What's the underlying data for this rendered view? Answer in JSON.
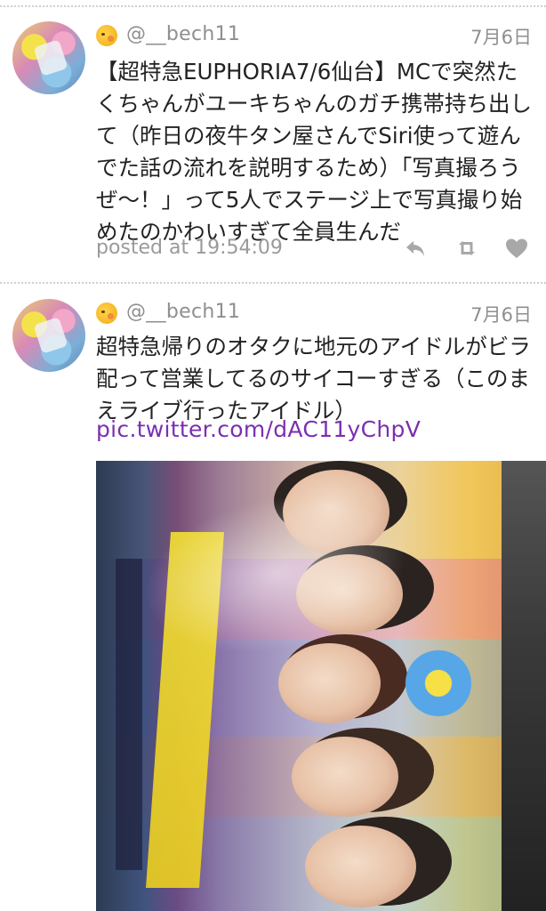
{
  "tweets": [
    {
      "emoji": "smiling-face-emoji",
      "handle": "@__bech11",
      "date": "7月6日",
      "text": "【超特急EUPHORIA7/6仙台】MCで突然たくちゃんがユーキちゃんのガチ携帯持ち出して（昨日の夜牛タン屋さんでSiri使って遊んでた話の流れを説明するため）「写真撮ろうぜ〜！」って5人でステージ上で写真撮り始めたのかわいすぎて全員生んだ",
      "posted_at": "posted at 19:54:09"
    },
    {
      "emoji": "smiling-face-emoji",
      "handle": "@__bech11",
      "date": "7月6日",
      "text": "超特急帰りのオタクに地元のアイドルがビラ配って営業してるのサイコーすぎる（このまえライブ行ったアイドル）",
      "link": "pic.twitter.com/dAC11yChpV"
    }
  ],
  "colors": {
    "link": "#7b2fb0",
    "meta_gray": "#8f8f8f",
    "icon_gray": "#a8a8a8"
  },
  "icons": [
    "reply-icon",
    "retweet-icon",
    "favorite-icon"
  ]
}
